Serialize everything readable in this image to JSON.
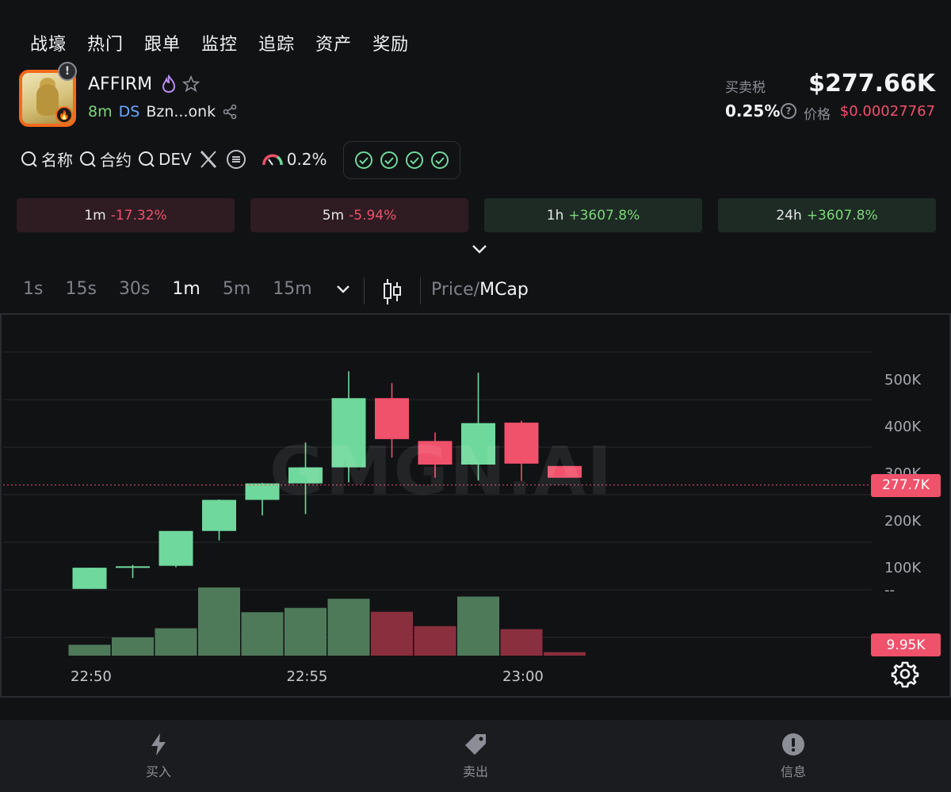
{
  "nav": [
    "战壕",
    "热门",
    "跟单",
    "监控",
    "追踪",
    "资产",
    "奖励"
  ],
  "token": {
    "name": "AFFIRM",
    "age": "8m",
    "ds": "DS",
    "address": "Bzn...onk"
  },
  "stats": {
    "tax_label": "买卖税",
    "tax_value": "0.25%",
    "market_cap": "$277.66K",
    "price_label": "价格",
    "price_value": "$0.00027767"
  },
  "search": {
    "name": "名称",
    "contract": "合约",
    "dev": "DEV",
    "gauge_value": "0.2%"
  },
  "changes": [
    {
      "label": "1m",
      "value": "-17.32%",
      "dir": "neg"
    },
    {
      "label": "5m",
      "value": "-5.94%",
      "dir": "neg"
    },
    {
      "label": "1h",
      "value": "+3607.8%",
      "dir": "pos"
    },
    {
      "label": "24h",
      "value": "+3607.8%",
      "dir": "pos"
    }
  ],
  "intervals": [
    "1s",
    "15s",
    "30s",
    "1m",
    "5m",
    "15m"
  ],
  "active_interval": "1m",
  "price_toggle": {
    "price": "Price/",
    "mcap": "MCap"
  },
  "chart_watermark": "GMGN.AI",
  "colors": {
    "up": "#6fd89c",
    "down": "#f0516b",
    "vol_up": "#4f7a5a",
    "vol_down": "#8a2f3d",
    "accent": "#f0516b"
  },
  "chart_data": {
    "type": "candlestick",
    "y_ticks": [
      "500K",
      "400K",
      "300K",
      "200K",
      "100K"
    ],
    "ylim": [
      55000,
      560000
    ],
    "x_ticks": [
      {
        "label": "22:50",
        "index": 0
      },
      {
        "label": "22:55",
        "index": 5
      },
      {
        "label": "23:00",
        "index": 10
      }
    ],
    "candles": [
      {
        "o": 57000,
        "h": 102000,
        "l": 57000,
        "c": 102000,
        "v": 2500
      },
      {
        "o": 102000,
        "h": 108000,
        "l": 80000,
        "c": 105000,
        "v": 4200
      },
      {
        "o": 106000,
        "h": 135000,
        "l": 103000,
        "c": 180000,
        "v": 6300
      },
      {
        "o": 180000,
        "h": 247000,
        "l": 160000,
        "c": 246000,
        "v": 15700
      },
      {
        "o": 246000,
        "h": 282000,
        "l": 213000,
        "c": 281000,
        "v": 10000
      },
      {
        "o": 281000,
        "h": 368000,
        "l": 216000,
        "c": 315000,
        "v": 11000
      },
      {
        "o": 315000,
        "h": 519000,
        "l": 283000,
        "c": 462000,
        "v": 13100
      },
      {
        "o": 462000,
        "h": 494000,
        "l": 336000,
        "c": 375000,
        "v": 10100
      },
      {
        "o": 371000,
        "h": 389000,
        "l": 293000,
        "c": 321000,
        "v": 6800
      },
      {
        "o": 321000,
        "h": 516000,
        "l": 287000,
        "c": 409000,
        "v": 13600
      },
      {
        "o": 410000,
        "h": 414000,
        "l": 286000,
        "c": 323000,
        "v": 6100
      },
      {
        "o": 318000,
        "h": 318000,
        "l": 293000,
        "c": 293000,
        "v": 800
      }
    ],
    "current_price_label": "277.7K",
    "current_price": 277700,
    "volume_label": "9.95K",
    "volume_axis_label": "--"
  },
  "bottom": {
    "buy": "买入",
    "sell": "卖出",
    "info": "信息"
  }
}
